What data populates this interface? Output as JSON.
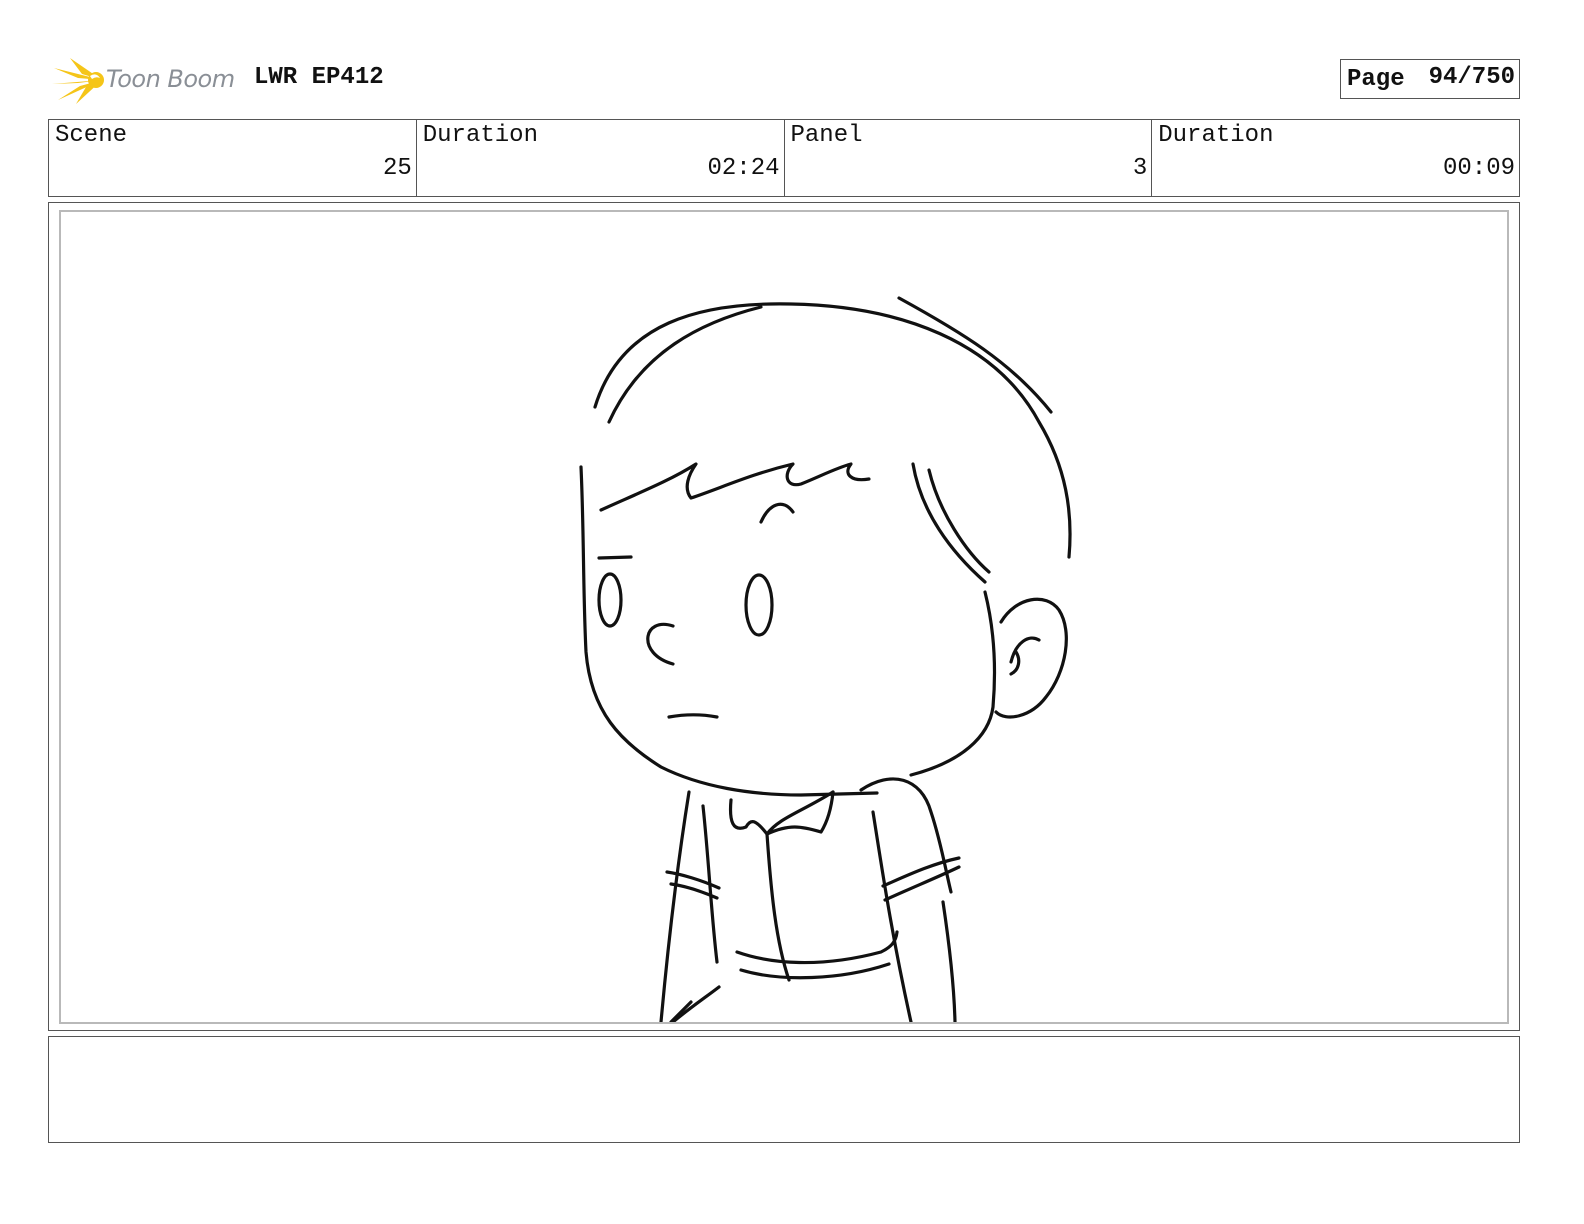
{
  "header": {
    "logo_text": "Toon Boom",
    "project_title": "LWR EP412",
    "page_label": "Page",
    "page_number": "94/750"
  },
  "info": [
    {
      "label": "Scene",
      "value": "25"
    },
    {
      "label": "Duration",
      "value": "02:24"
    },
    {
      "label": "Panel",
      "value": "3"
    },
    {
      "label": "Duration",
      "value": "00:09"
    }
  ],
  "notes": {
    "text": ""
  },
  "colors": {
    "logo_flame": "#f5c518",
    "logo_text": "#8a8f96",
    "border": "#555555",
    "panel_border": "#b9b9b9",
    "ink": "#111111"
  }
}
